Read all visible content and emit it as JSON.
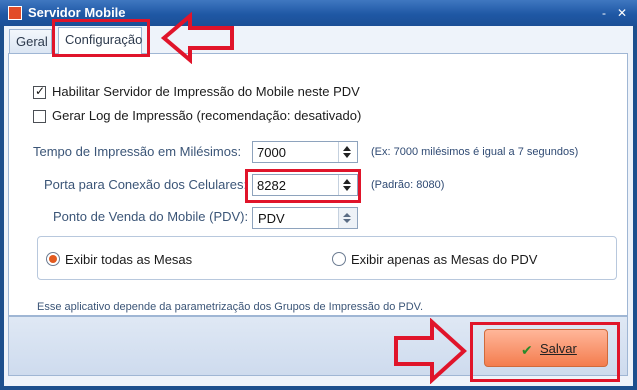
{
  "window": {
    "title": "Servidor Mobile",
    "minimize_glyph": "‑",
    "close_glyph": "✕",
    "icon": "app-icon"
  },
  "tabs": [
    {
      "label": "Geral",
      "active": false
    },
    {
      "label": "Configuração",
      "active": true
    }
  ],
  "options": {
    "enable_server": {
      "label": "Habilitar Servidor de Impressão do Mobile neste PDV",
      "checked": true
    },
    "log": {
      "label": "Gerar Log de Impressão (recomendação: desativado)",
      "checked": false
    }
  },
  "fields": {
    "print_time": {
      "label": "Tempo de Impressão em Milésimos:",
      "value": "7000",
      "hint": "(Ex: 7000 milésimos é igual a 7 segundos)"
    },
    "port": {
      "label": "Porta para Conexão dos Celulares:",
      "value": "8282",
      "hint": "(Padrão: 8080)"
    },
    "pdv": {
      "label": "Ponto de Venda do Mobile (PDV):",
      "value": "PDV"
    }
  },
  "radios": [
    {
      "label": "Exibir todas as Mesas",
      "selected": true
    },
    {
      "label": "Exibir apenas as Mesas do PDV",
      "selected": false
    }
  ],
  "note": "Esse aplicativo depende da parametrização dos Grupos de Impressão do PDV.",
  "actions": {
    "save_label": "Salvar",
    "save_icon": "checkmark-icon"
  },
  "colors": {
    "titlebar": "#1f58a5",
    "accent": "#e25a1f",
    "highlight": "#e0142a",
    "save_button": "#f47d4f"
  }
}
